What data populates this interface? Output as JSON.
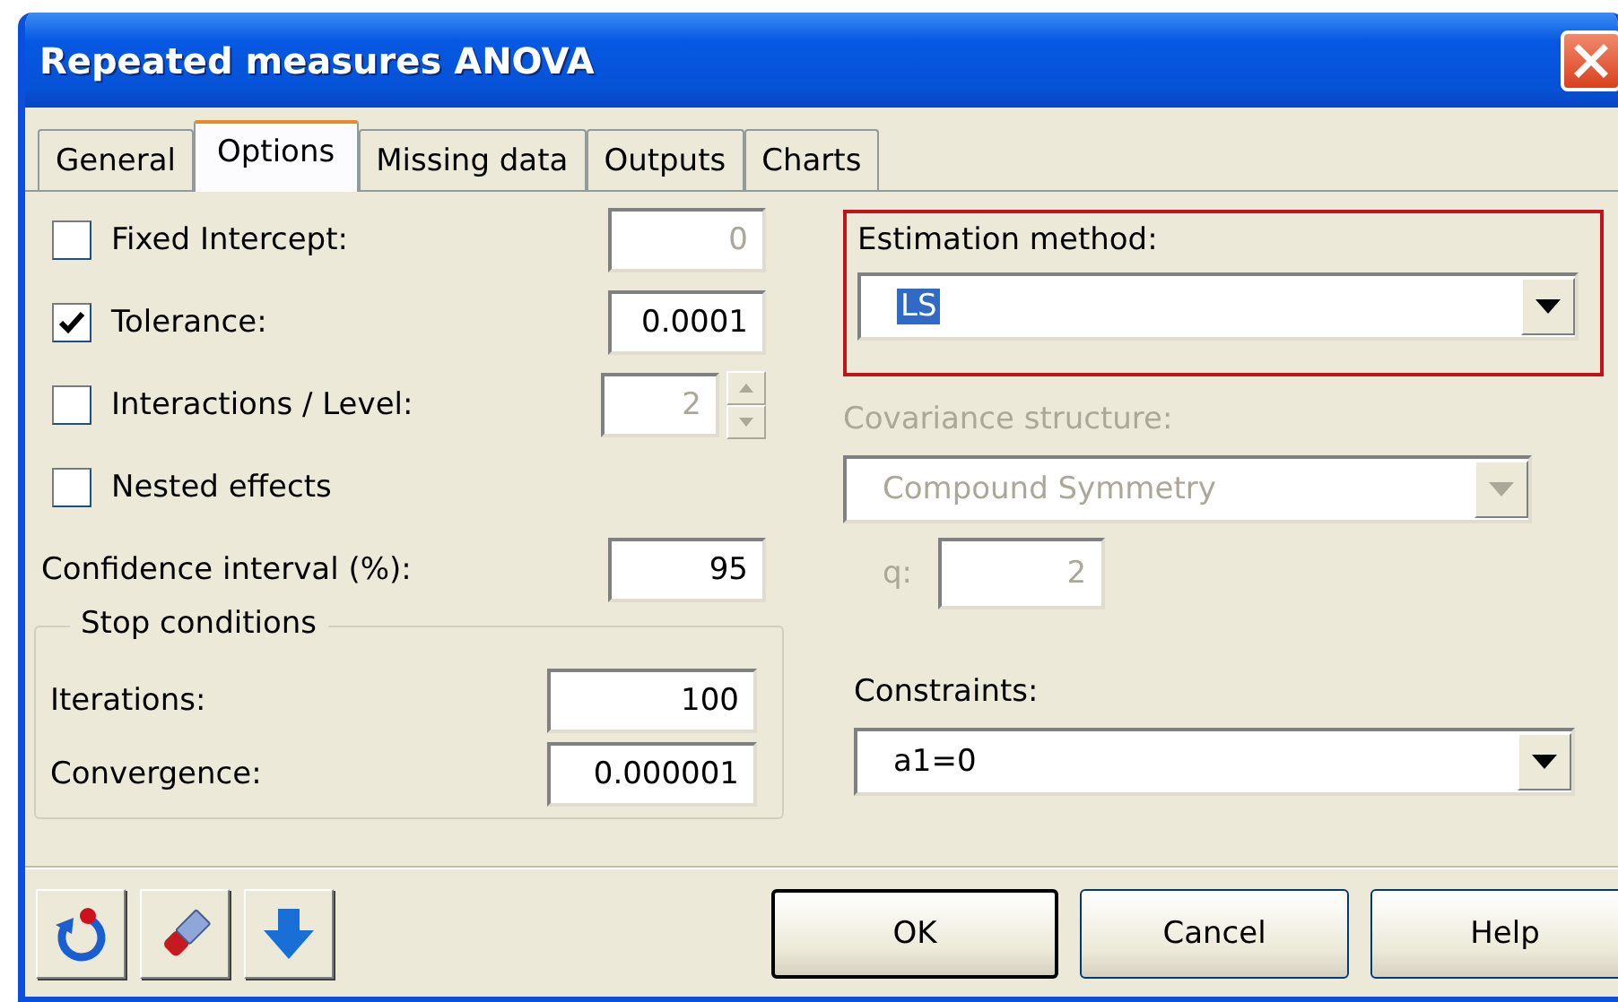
{
  "window": {
    "title": "Repeated measures ANOVA"
  },
  "tabs": [
    {
      "label": "General",
      "selected": false
    },
    {
      "label": "Options",
      "selected": true
    },
    {
      "label": "Missing data",
      "selected": false
    },
    {
      "label": "Outputs",
      "selected": false
    },
    {
      "label": "Charts",
      "selected": false
    }
  ],
  "options": [
    {
      "kind": "checkbox",
      "label": "Fixed Intercept:",
      "checked": false,
      "value": "0",
      "disabled": true
    },
    {
      "kind": "checkbox",
      "label": "Tolerance:",
      "checked": true,
      "value": "0.0001",
      "disabled": false
    },
    {
      "kind": "spin",
      "label": "Interactions / Level:",
      "checked": false,
      "value": "2",
      "disabled": true
    },
    {
      "kind": "check-only",
      "label": "Nested effects",
      "checked": false
    },
    {
      "kind": "field",
      "label": "Confidence interval (%):",
      "value": "95",
      "disabled": false
    }
  ],
  "stop_conditions": {
    "title": "Stop conditions",
    "fields": [
      {
        "label": "Iterations:",
        "value": "100"
      },
      {
        "label": "Convergence:",
        "value": "0.000001"
      }
    ]
  },
  "estimation": {
    "label": "Estimation method:",
    "value": "LS",
    "text_selected": true,
    "outlined": true
  },
  "covariance": {
    "label": "Covariance structure:",
    "value": "Compound Symmetry",
    "disabled": true,
    "q_label": "q:",
    "q_value": "2"
  },
  "constraints": {
    "label": "Constraints:",
    "value": "a1=0"
  },
  "buttons": [
    {
      "label": "OK",
      "default": true
    },
    {
      "label": "Cancel",
      "default": false
    },
    {
      "label": "Help",
      "default": false
    }
  ]
}
